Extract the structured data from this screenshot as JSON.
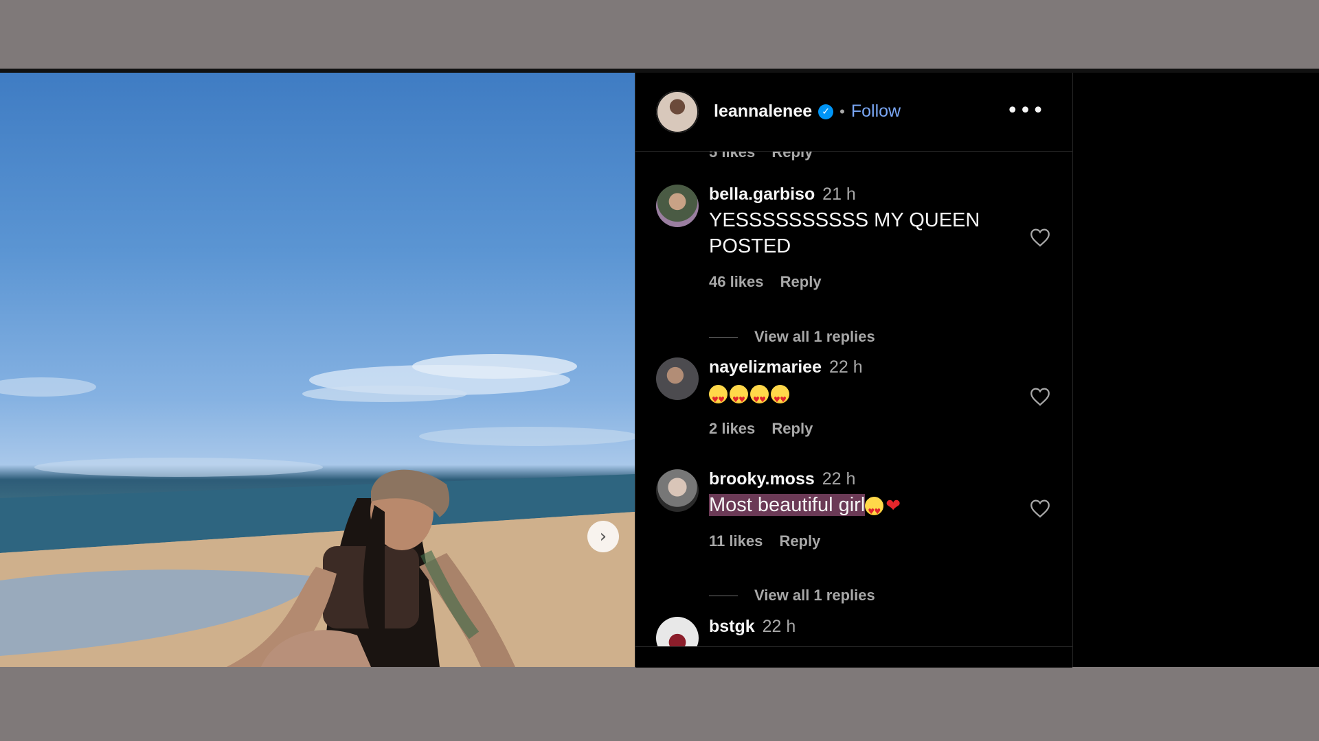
{
  "header": {
    "username": "leannalenee",
    "verified_icon": "verified-badge-icon",
    "separator": "•",
    "follow_label": "Follow",
    "more_label": "•••"
  },
  "partial_comment": {
    "likes": "5 likes",
    "reply": "Reply"
  },
  "comments": [
    {
      "username": "bella.garbiso",
      "time": "21 h",
      "text": "YESSSSSSSSSS MY QUEEN POSTED",
      "likes": "46 likes",
      "reply": "Reply",
      "view_replies": "View all 1 replies"
    },
    {
      "username": "nayelizmariee",
      "time": "22 h",
      "text_emoji": "heart-eyes-emoji x4",
      "likes": "2 likes",
      "reply": "Reply"
    },
    {
      "username": "brooky.moss",
      "time": "22 h",
      "text": "Most beautiful girl",
      "text_suffix_emoji": "heart-eyes-emoji, red-heart-emoji",
      "likes": "11 likes",
      "reply": "Reply",
      "view_replies": "View all 1 replies"
    },
    {
      "username": "bstgk",
      "time": "22 h"
    }
  ],
  "photo": {
    "next_label": "›"
  },
  "colors": {
    "background": "#7f7979",
    "panel": "#000000",
    "follow": "#7aa7f5",
    "secondary_text": "#a8a8a8",
    "highlight": "#6b3a56",
    "verified": "#0095f6"
  }
}
